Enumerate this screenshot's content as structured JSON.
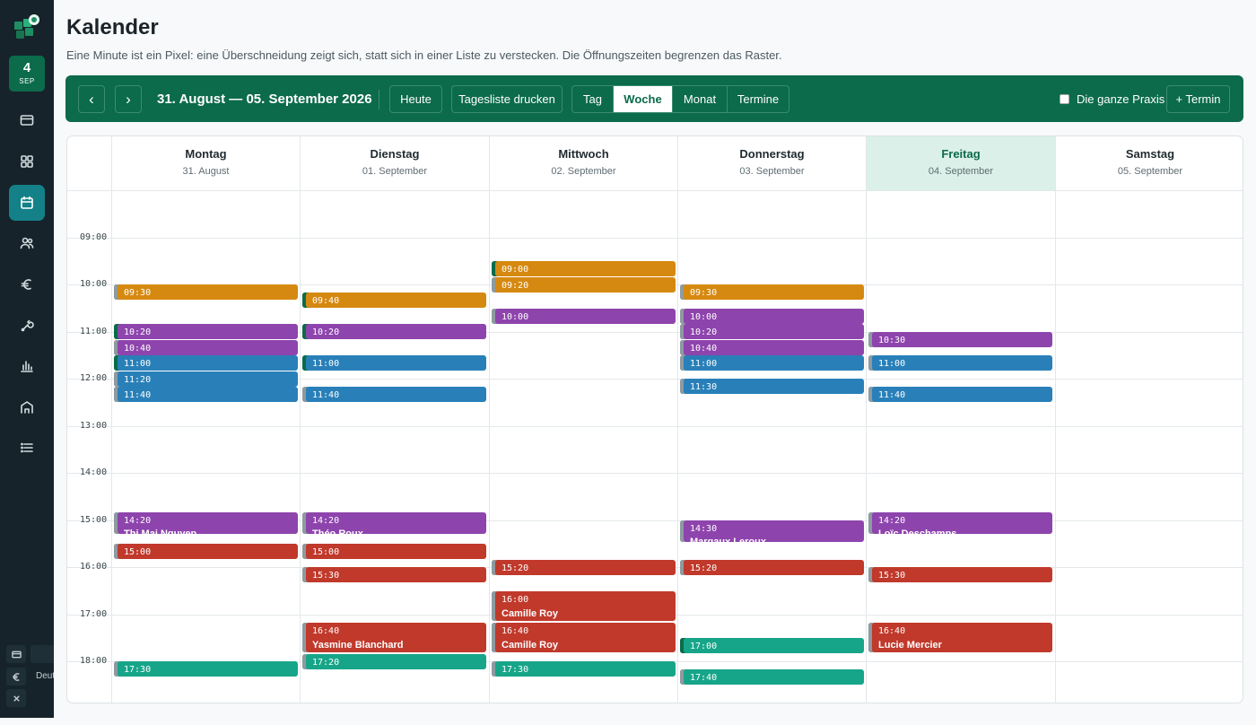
{
  "page": {
    "title": "Kalender",
    "subtitle": "Eine Minute ist ein Pixel: eine Überschneidung zeigt sich, statt sich in einer Liste zu verstecken. Die Öffnungszeiten begrenzen das Raster."
  },
  "sidebar": {
    "date_day": "4",
    "date_month": "SEP",
    "items": [
      {
        "name": "card-icon",
        "active": false
      },
      {
        "name": "grid-icon",
        "active": false
      },
      {
        "name": "calendar-icon",
        "active": true
      },
      {
        "name": "users-icon",
        "active": false
      },
      {
        "name": "euro-icon",
        "active": false
      },
      {
        "name": "tools-icon",
        "active": false
      },
      {
        "name": "chart-icon",
        "active": false
      },
      {
        "name": "building-icon",
        "active": false
      },
      {
        "name": "list-icon",
        "active": false
      }
    ],
    "lang_label": "Deutsch"
  },
  "toolbar": {
    "prev": "‹",
    "next": "›",
    "range": "31. August — 05. September 2026",
    "today": "Heute",
    "print": "Tagesliste drucken",
    "views": [
      "Tag",
      "Woche",
      "Monat",
      "Termine"
    ],
    "active_view": "Woche",
    "practice_checkbox": "Die ganze Praxis",
    "practice_checked": false,
    "new_appointment": "+ Termin"
  },
  "calendar": {
    "days": [
      {
        "name": "Montag",
        "date": "31. August",
        "today": false
      },
      {
        "name": "Dienstag",
        "date": "01. September",
        "today": false
      },
      {
        "name": "Mittwoch",
        "date": "02. September",
        "today": false
      },
      {
        "name": "Donnerstag",
        "date": "03. September",
        "today": false
      },
      {
        "name": "Freitag",
        "date": "04. September",
        "today": true
      },
      {
        "name": "Samstag",
        "date": "05. September",
        "today": false
      }
    ],
    "hours": [
      "09:00",
      "10:00",
      "11:00",
      "12:00",
      "13:00",
      "14:00",
      "15:00",
      "16:00",
      "17:00",
      "18:00"
    ],
    "colors": {
      "or": "#d68910",
      "pu": "#8e44ad",
      "bl": "#2980b9",
      "re": "#c0392b",
      "te": "#17a589"
    },
    "events": [
      {
        "day": 0,
        "time": "09:30",
        "color": "or",
        "patient": ""
      },
      {
        "day": 0,
        "time": "10:20",
        "color": "pu",
        "patient": "",
        "accent": "green"
      },
      {
        "day": 0,
        "time": "10:40",
        "color": "pu",
        "patient": ""
      },
      {
        "day": 0,
        "time": "11:00",
        "color": "bl",
        "patient": "",
        "accent": "green"
      },
      {
        "day": 0,
        "time": "11:20",
        "color": "bl",
        "patient": ""
      },
      {
        "day": 0,
        "time": "11:40",
        "color": "bl",
        "patient": ""
      },
      {
        "day": 0,
        "time": "14:20",
        "color": "pu",
        "patient": "Thi Mai Nguyen",
        "clipped": true
      },
      {
        "day": 0,
        "time": "15:00",
        "color": "re",
        "patient": ""
      },
      {
        "day": 0,
        "time": "17:30",
        "color": "te",
        "patient": ""
      },
      {
        "day": 1,
        "time": "09:40",
        "color": "or",
        "patient": "",
        "accent": "green"
      },
      {
        "day": 1,
        "time": "10:20",
        "color": "pu",
        "patient": "",
        "accent": "green"
      },
      {
        "day": 1,
        "time": "11:00",
        "color": "bl",
        "patient": "",
        "accent": "green"
      },
      {
        "day": 1,
        "time": "11:40",
        "color": "bl",
        "patient": ""
      },
      {
        "day": 1,
        "time": "14:20",
        "color": "pu",
        "patient": "Théo Roux",
        "clipped": true
      },
      {
        "day": 1,
        "time": "15:00",
        "color": "re",
        "patient": ""
      },
      {
        "day": 1,
        "time": "15:30",
        "color": "re",
        "patient": ""
      },
      {
        "day": 1,
        "time": "16:40",
        "color": "re",
        "patient": "Yasmine Blanchard"
      },
      {
        "day": 1,
        "time": "17:20",
        "color": "te",
        "patient": ""
      },
      {
        "day": 2,
        "time": "09:00",
        "color": "or",
        "patient": "",
        "accent": "green"
      },
      {
        "day": 2,
        "time": "09:20",
        "color": "or",
        "patient": ""
      },
      {
        "day": 2,
        "time": "10:00",
        "color": "pu",
        "patient": ""
      },
      {
        "day": 2,
        "time": "15:20",
        "color": "re",
        "patient": ""
      },
      {
        "day": 2,
        "time": "16:00",
        "color": "re",
        "patient": "Camille Roy"
      },
      {
        "day": 2,
        "time": "16:40",
        "color": "re",
        "patient": "Camille Roy"
      },
      {
        "day": 2,
        "time": "17:30",
        "color": "te",
        "patient": ""
      },
      {
        "day": 3,
        "time": "09:30",
        "color": "or",
        "patient": ""
      },
      {
        "day": 3,
        "time": "10:00",
        "color": "pu",
        "patient": ""
      },
      {
        "day": 3,
        "time": "10:20",
        "color": "pu",
        "patient": ""
      },
      {
        "day": 3,
        "time": "10:40",
        "color": "pu",
        "patient": ""
      },
      {
        "day": 3,
        "time": "11:00",
        "color": "bl",
        "patient": ""
      },
      {
        "day": 3,
        "time": "11:30",
        "color": "bl",
        "patient": ""
      },
      {
        "day": 3,
        "time": "14:30",
        "color": "pu",
        "patient": "Margaux Leroux",
        "clipped": true
      },
      {
        "day": 3,
        "time": "15:20",
        "color": "re",
        "patient": ""
      },
      {
        "day": 3,
        "time": "17:00",
        "color": "te",
        "patient": "",
        "accent": "green"
      },
      {
        "day": 3,
        "time": "17:40",
        "color": "te",
        "patient": ""
      },
      {
        "day": 4,
        "time": "10:30",
        "color": "pu",
        "patient": ""
      },
      {
        "day": 4,
        "time": "11:00",
        "color": "bl",
        "patient": ""
      },
      {
        "day": 4,
        "time": "11:40",
        "color": "bl",
        "patient": ""
      },
      {
        "day": 4,
        "time": "14:20",
        "color": "pu",
        "patient": "Loïc Deschamps",
        "clipped": true
      },
      {
        "day": 4,
        "time": "15:30",
        "color": "re",
        "patient": ""
      },
      {
        "day": 4,
        "time": "16:40",
        "color": "re",
        "patient": "Lucie Mercier"
      }
    ]
  }
}
